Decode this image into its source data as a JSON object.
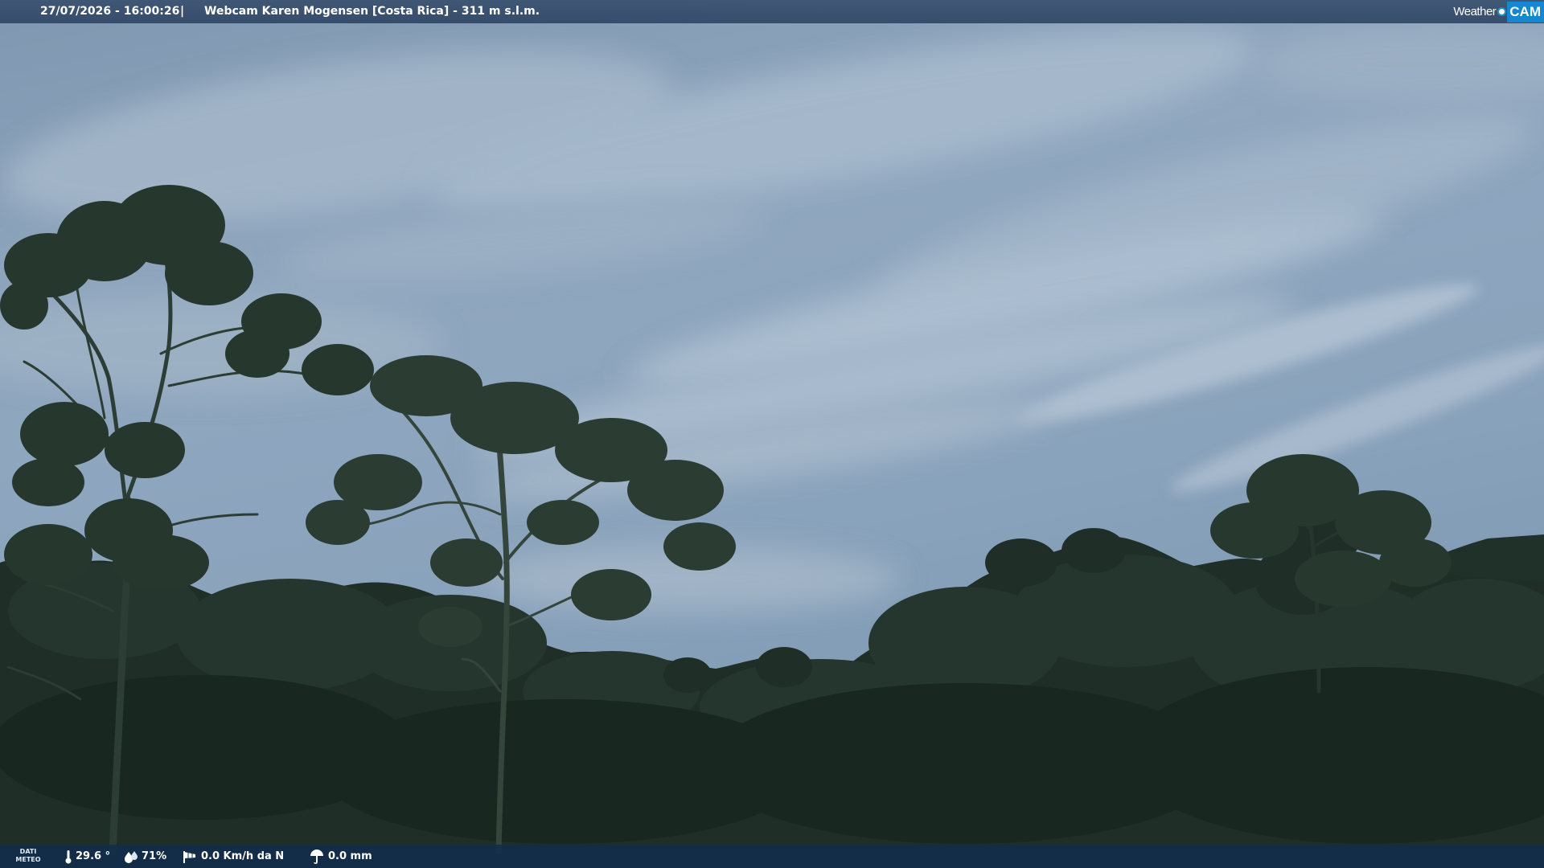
{
  "header": {
    "datetime": "27/07/2026 - 16:00:26",
    "separator": "|",
    "camera_title": "Webcam Karen Mogensen [Costa Rica]  - 311 m s.l.m."
  },
  "logo": {
    "left_text": "Weather",
    "right_text": "CAM",
    "accent_color": "#1586d0"
  },
  "weather": {
    "label_line1": "DATI",
    "label_line2": "METEO",
    "temperature": "29.6 °",
    "humidity": "71%",
    "wind": "0.0 Km/h da N",
    "rain": "0.0 mm"
  },
  "icons": {
    "temperature": "thermometer-icon",
    "humidity": "droplets-icon",
    "wind": "windsock-icon",
    "rain": "rain-gauge-icon"
  }
}
